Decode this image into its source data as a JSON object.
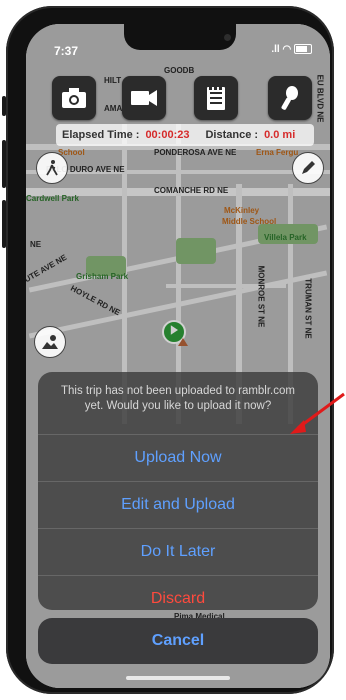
{
  "status_bar": {
    "time": "7:37",
    "signal": ".ll",
    "wifi": "wifi"
  },
  "map": {
    "labels": {
      "hilton": "HILT",
      "lamar": "AMAR",
      "school": "School",
      "ponderosa": "PONDEROSA AVE NE",
      "erna": "Erna Fergu",
      "palo_duro": "PALO DURO AVE NE",
      "cardwell": "Cardwell Park",
      "comanche": "COMANCHE RD NE",
      "mckinley": "McKinley",
      "middle_school": "Middle School",
      "villela": "Villela Park",
      "grisham": "Grisham Park",
      "hoyle": "HOYLE RD NE",
      "monroe": "MONROE ST NE",
      "truman": "TRUMAN ST NE",
      "ute": "UTE AVE NE",
      "ne": "NE",
      "eubank": "EU BLVD NE",
      "pima": "Pima Medical",
      "goodb": "GOODB"
    }
  },
  "toolbar": {
    "camera": "camera-icon",
    "video": "video-camera-icon",
    "notes": "notepad-icon",
    "mic": "microphone-icon"
  },
  "stats": {
    "elapsed_label": "Elapsed Time :",
    "elapsed_value": "00:00:23",
    "distance_label": "Distance :",
    "distance_value": "0.0 mi"
  },
  "dialog": {
    "message": "This trip has not been uploaded to ramblr.com yet. Would you like to upload it now?",
    "options": [
      "Upload Now",
      "Edit and Upload",
      "Do It Later",
      "Discard"
    ],
    "cancel": "Cancel"
  },
  "colors": {
    "action_blue": "#5fa0ff",
    "destructive_red": "#ff4a3d",
    "elapsed_red": "#d62b2b",
    "arrow_red": "#e01a1a"
  }
}
